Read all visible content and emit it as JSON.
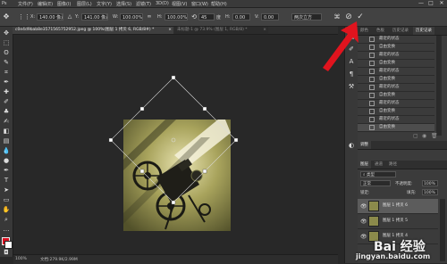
{
  "menubar": {
    "items": [
      "文件(F)",
      "编辑(E)",
      "图像(I)",
      "图层(L)",
      "文字(Y)",
      "选择(S)",
      "滤镜(T)",
      "3D(D)",
      "视图(V)",
      "窗口(W)",
      "帮助(H)"
    ],
    "window_controls": [
      "—",
      "□",
      "✕"
    ]
  },
  "options": {
    "x_label": "X:",
    "x_value": "140.00 像素",
    "y_label": "Y:",
    "y_value": "141.00 像素",
    "w_label": "W:",
    "w_value": "100.00%",
    "h_label": "H:",
    "h_value": "100.00%",
    "angle_value": "45",
    "angle_unit": "度",
    "hskew_label": "H:",
    "hskew_value": "0.00",
    "vskew_label": "V:",
    "vskew_value": "0.00",
    "interp_value": "两次立方",
    "cancel_symbol": "⊘",
    "commit_symbol": "✓"
  },
  "tabs": [
    {
      "label": "c0e4d9bab8e3571565752952.jpeg @ 100%(图层 1 拷贝 6, RGB/8#) *",
      "close": "×",
      "active": true
    },
    {
      "label": "未标题-1 @ 73.9% (图层 1, RGB/8) *",
      "close": "×",
      "active": false
    }
  ],
  "status": {
    "zoom": "100%",
    "doc": "文档:279.9K/2.99M"
  },
  "panel": {
    "top_tabs": [
      "颜色",
      "色板",
      "历史记录",
      "历史记录"
    ],
    "history_items": [
      "最近的状态",
      "自由变换",
      "最近的状态",
      "自由变换",
      "最近的状态",
      "自由变换",
      "最近的状态",
      "自由变换",
      "最近的状态",
      "自由变换",
      "最近的状态",
      "自由变换"
    ],
    "mid_tabs": [
      "调整"
    ],
    "layer_tabs": [
      "图层",
      "通道",
      "路径"
    ],
    "blend_mode": "正常",
    "opacity_label": "不透明度:",
    "opacity_value": "100%",
    "lock_label": "锁定:",
    "fill_label": "填充:",
    "fill_value": "100%",
    "layers": [
      {
        "name": "图层 1 拷贝 6"
      },
      {
        "name": "图层 1 拷贝 5"
      },
      {
        "name": "图层 1 拷贝 4"
      }
    ]
  },
  "watermark": {
    "line1": "Bai 经验",
    "line2": "jingyan.baidu.com"
  },
  "colors": {
    "arrow": "#e0141e",
    "foreground": "#d81020",
    "background": "#ffffff"
  }
}
